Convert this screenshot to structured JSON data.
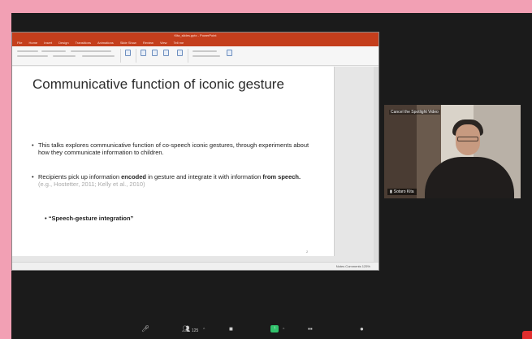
{
  "ppt": {
    "doc_title": "Kita_slides.pptx - PowerPoint",
    "menu": [
      "File",
      "Home",
      "Insert",
      "Design",
      "Transitions",
      "Animations",
      "Slide Show",
      "Review",
      "View",
      "Tell me"
    ],
    "status": "Notes   Comments   125%"
  },
  "slide": {
    "title": "Communicative function of iconic gesture",
    "bullet1": "This talks explores communicative function of co-speech iconic gestures, through experiments about how they communicate information to children.",
    "bullet2_prefix": "Recipients pick up information ",
    "bullet2_bold1": "encoded",
    "bullet2_middle": " in gesture and integrate it with information ",
    "bullet2_bold2": "from speech.",
    "bullet2_cite": " (e.g., Hostetter, 2011; Kelly et al., 2010)",
    "sub_bullet": "•  “Speech-gesture integration”",
    "number": "2"
  },
  "video": {
    "top_label": "Cancel the Spotlight Video",
    "participant_name": "Sotaro Kita"
  },
  "toolbar": {
    "participants_count": "125"
  },
  "colors": {
    "page_background": "#f2a0b4",
    "zoom_background": "#1b1b1b",
    "ppt_accent": "#c43e1c",
    "share_green": "#31c26c",
    "leave_red": "#e02d2d"
  },
  "icons": [
    "microphone-icon",
    "participants-icon",
    "chat-icon",
    "share-screen-icon",
    "record-icon",
    "reactions-icon",
    "leave-icon"
  ]
}
